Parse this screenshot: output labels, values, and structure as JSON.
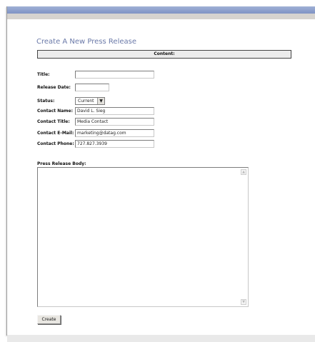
{
  "page": {
    "title": "Create A New Press Release",
    "section_header": "Content:"
  },
  "form": {
    "title": {
      "label": "Title:",
      "value": ""
    },
    "release_date": {
      "label": "Release Date:",
      "value": ""
    },
    "status": {
      "label": "Status:",
      "value": "Current"
    },
    "contact_name": {
      "label": "Contact Name:",
      "value": "David L. Sieg"
    },
    "contact_title": {
      "label": "Contact Title:",
      "value": "Media Contact"
    },
    "contact_email": {
      "label": "Contact E-Mail:",
      "value": "marketing@datag.com"
    },
    "contact_phone": {
      "label": "Contact Phone:",
      "value": "727.827.3939"
    },
    "body": {
      "label": "Press Release Body:",
      "value": ""
    },
    "submit_label": "Create"
  },
  "icons": {
    "status_dropdown": "chevron-down-icon",
    "scroll_up": "scroll-up-arrow-icon",
    "scroll_down": "scroll-down-arrow-icon"
  },
  "colors": {
    "title_text": "#6a79a8",
    "top_bar": "#8d9fcd"
  }
}
